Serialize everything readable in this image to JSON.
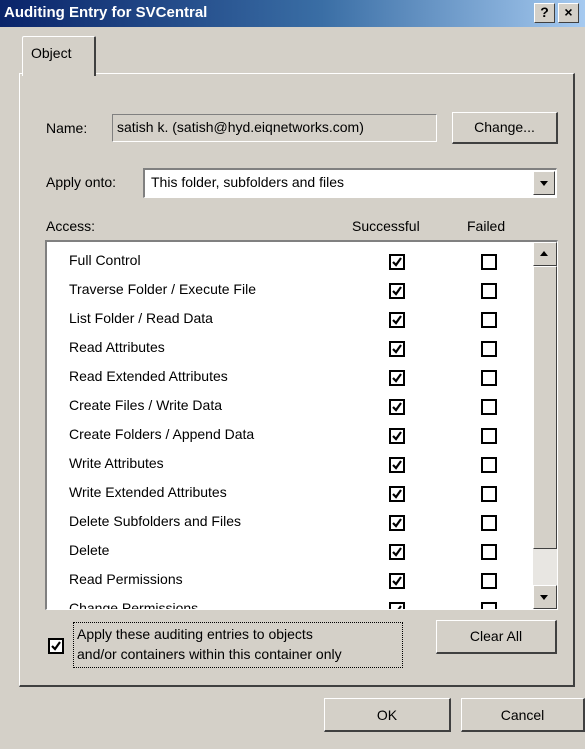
{
  "window": {
    "title": "Auditing Entry for SVCentral",
    "help_label": "?",
    "close_label": "×"
  },
  "tabs": [
    {
      "label": "Object"
    }
  ],
  "name_label": "Name:",
  "name_value": "satish k. (satish@hyd.eiqnetworks.com)",
  "change_label": "Change...",
  "apply_onto_label": "Apply onto:",
  "apply_onto_value": "This folder, subfolders and files",
  "access_label": "Access:",
  "col_successful": "Successful",
  "col_failed": "Failed",
  "access_entries": [
    {
      "label": "Full Control",
      "successful": true,
      "failed": false
    },
    {
      "label": "Traverse Folder / Execute File",
      "successful": true,
      "failed": false
    },
    {
      "label": "List Folder / Read Data",
      "successful": true,
      "failed": false
    },
    {
      "label": "Read Attributes",
      "successful": true,
      "failed": false
    },
    {
      "label": "Read Extended Attributes",
      "successful": true,
      "failed": false
    },
    {
      "label": "Create Files / Write Data",
      "successful": true,
      "failed": false
    },
    {
      "label": "Create Folders / Append Data",
      "successful": true,
      "failed": false
    },
    {
      "label": "Write Attributes",
      "successful": true,
      "failed": false
    },
    {
      "label": "Write Extended Attributes",
      "successful": true,
      "failed": false
    },
    {
      "label": "Delete Subfolders and Files",
      "successful": true,
      "failed": false
    },
    {
      "label": "Delete",
      "successful": true,
      "failed": false
    },
    {
      "label": "Read Permissions",
      "successful": true,
      "failed": false
    },
    {
      "label": "Change Permissions",
      "successful": true,
      "failed": false
    }
  ],
  "apply_checkbox": {
    "checked": true,
    "line1": "Apply these auditing entries to objects",
    "line2": "and/or containers within this container only"
  },
  "clear_all_label": "Clear All",
  "ok_label": "OK",
  "cancel_label": "Cancel"
}
